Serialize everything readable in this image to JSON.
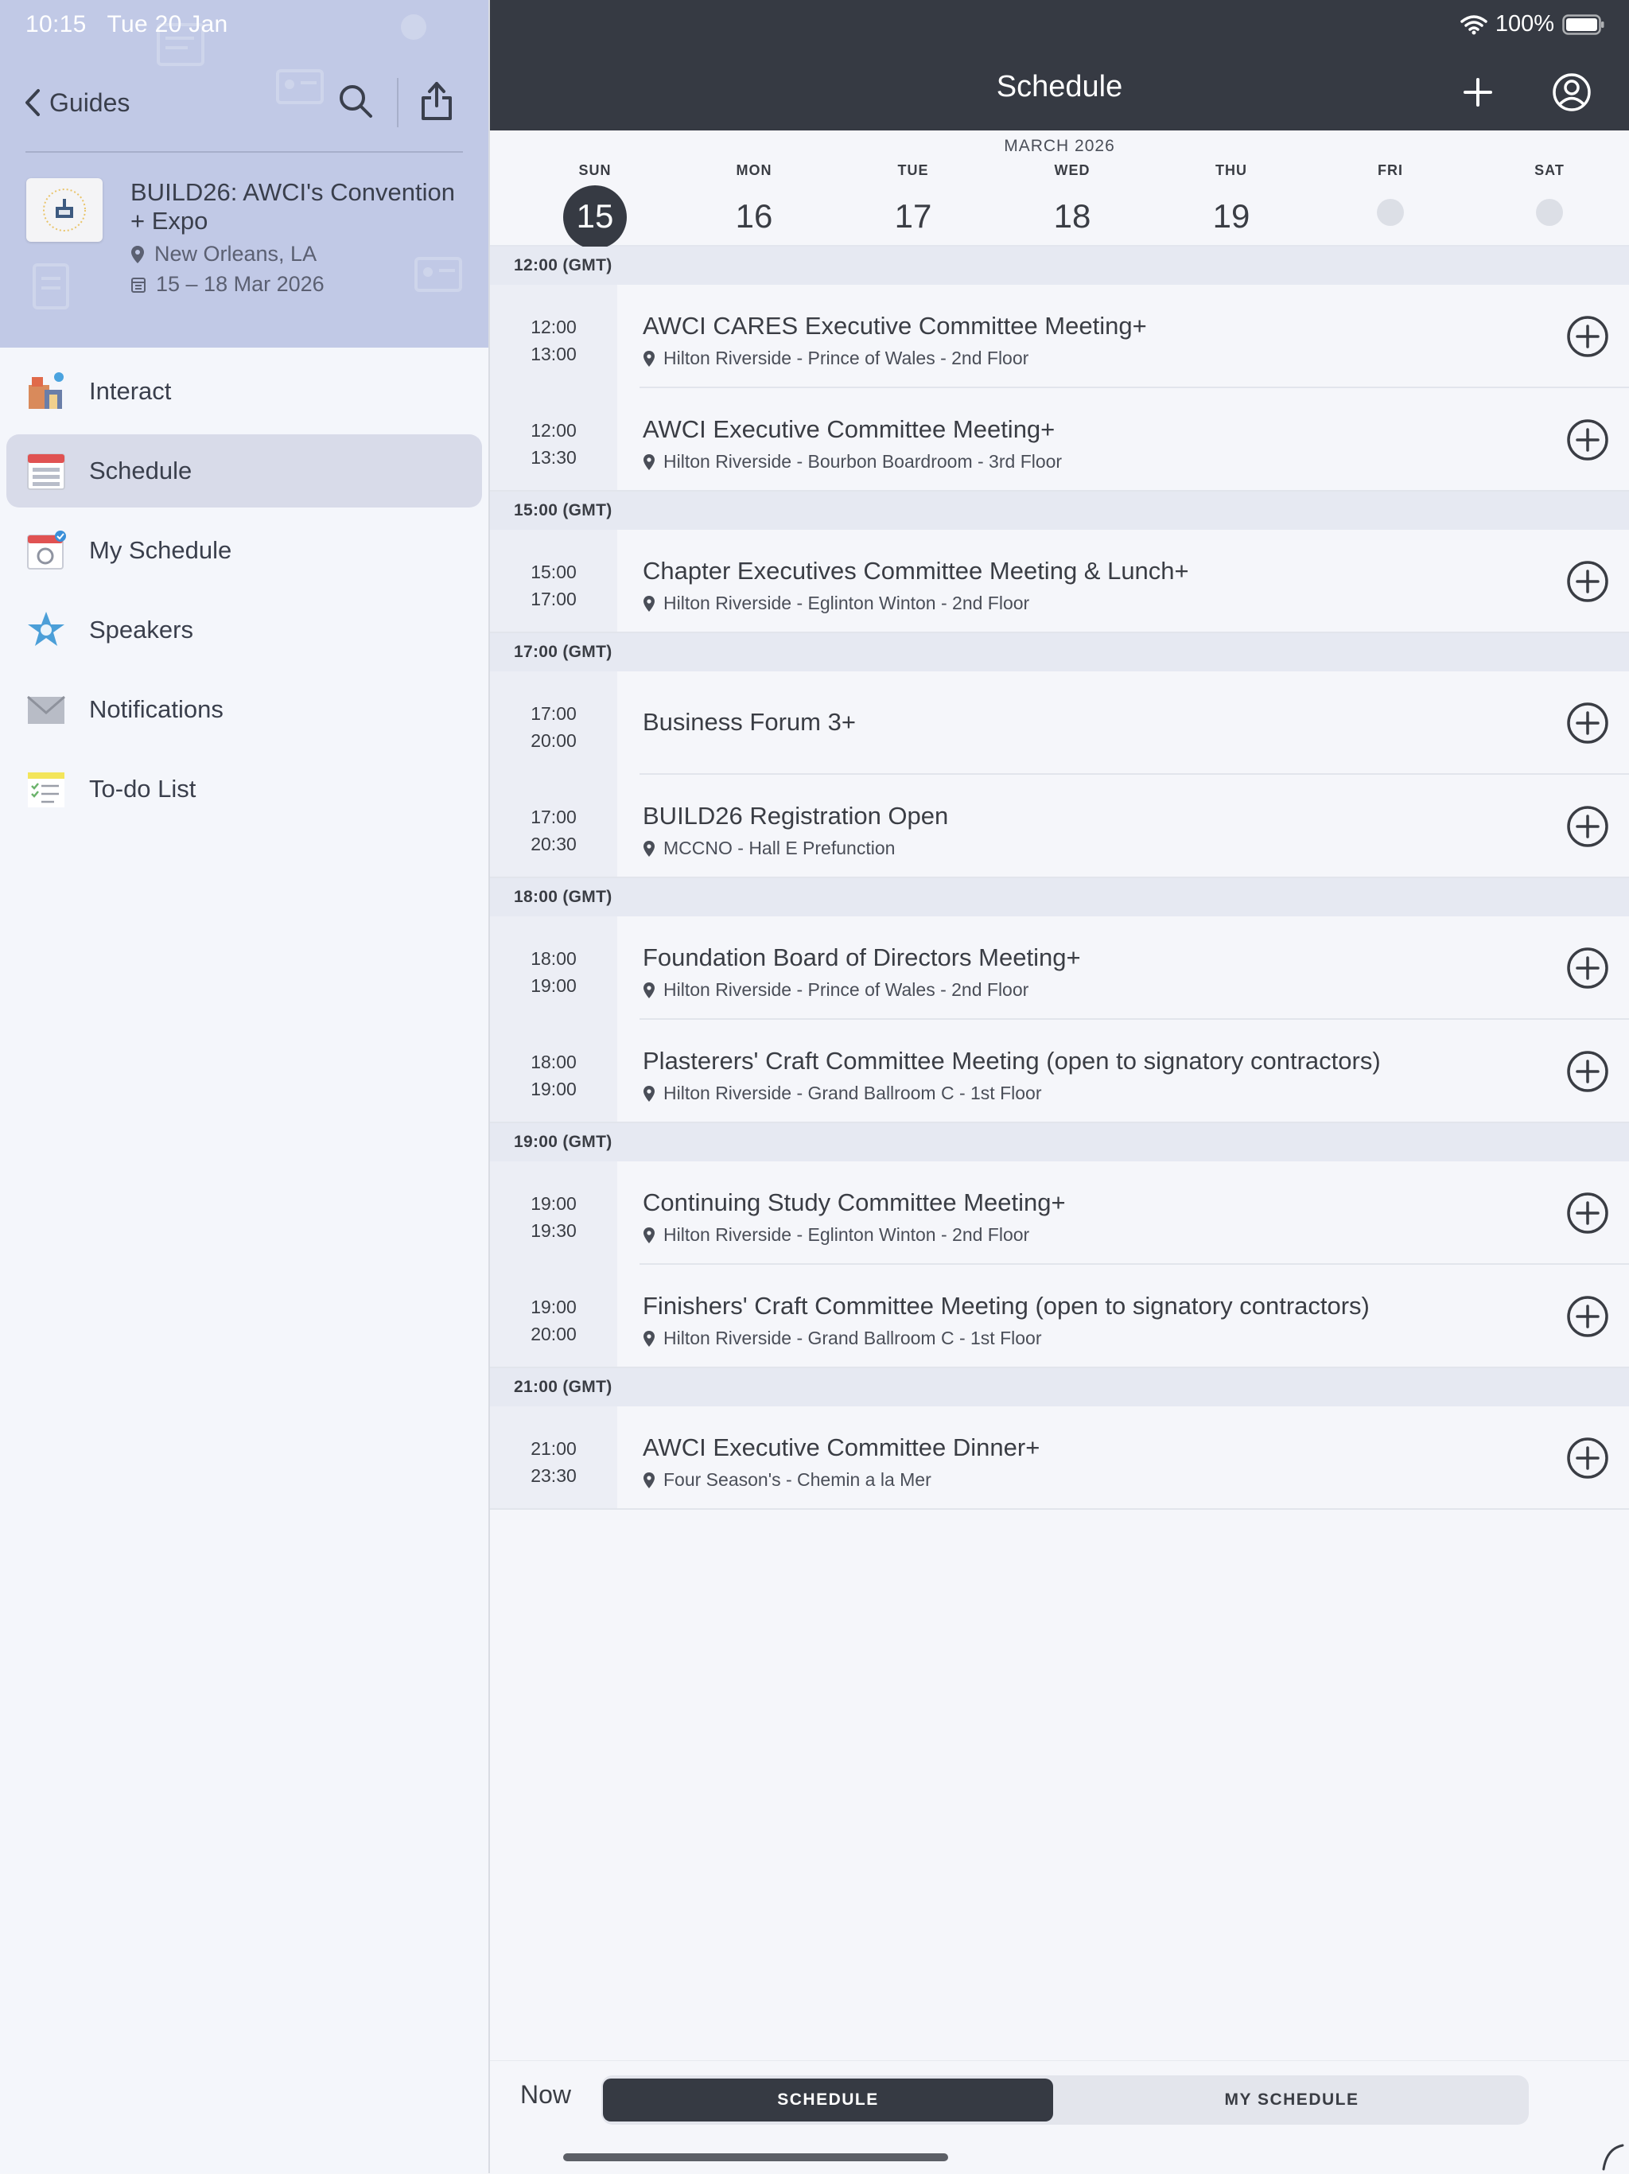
{
  "status_bar": {
    "time": "10:15",
    "date": "Tue 20 Jan",
    "battery": "100%"
  },
  "sidebar": {
    "back_label": "Guides",
    "event": {
      "title": "BUILD26: AWCI's Convention + Expo",
      "location": "New Orleans, LA",
      "dates": "15 – 18 Mar 2026"
    },
    "nav_items": [
      {
        "label": "Interact",
        "icon": "interact-icon",
        "active": false
      },
      {
        "label": "Schedule",
        "icon": "schedule-icon",
        "active": true
      },
      {
        "label": "My Schedule",
        "icon": "my-schedule-icon",
        "active": false
      },
      {
        "label": "Speakers",
        "icon": "star-icon",
        "active": false
      },
      {
        "label": "Notifications",
        "icon": "envelope-icon",
        "active": false
      },
      {
        "label": "To-do List",
        "icon": "todo-list-icon",
        "active": false
      }
    ]
  },
  "header": {
    "title": "Schedule"
  },
  "calendar": {
    "month": "MARCH 2026",
    "days": [
      {
        "name": "SUN",
        "num": "15",
        "selected": true,
        "has_events": true
      },
      {
        "name": "MON",
        "num": "16",
        "selected": false,
        "has_events": true
      },
      {
        "name": "TUE",
        "num": "17",
        "selected": false,
        "has_events": true
      },
      {
        "name": "WED",
        "num": "18",
        "selected": false,
        "has_events": true
      },
      {
        "name": "THU",
        "num": "19",
        "selected": false,
        "has_events": true
      },
      {
        "name": "FRI",
        "num": "",
        "selected": false,
        "has_events": false
      },
      {
        "name": "SAT",
        "num": "",
        "selected": false,
        "has_events": false
      }
    ]
  },
  "schedule": {
    "groups": [
      {
        "header": "12:00 (GMT)",
        "sessions": [
          {
            "start": "12:00",
            "end": "13:00",
            "title": "AWCI CARES Executive Committee Meeting+",
            "location": "Hilton Riverside - Prince of Wales - 2nd Floor"
          },
          {
            "start": "12:00",
            "end": "13:30",
            "title": "AWCI Executive Committee Meeting+",
            "location": "Hilton Riverside - Bourbon Boardroom - 3rd Floor"
          }
        ]
      },
      {
        "header": "15:00 (GMT)",
        "sessions": [
          {
            "start": "15:00",
            "end": "17:00",
            "title": "Chapter Executives Committee Meeting & Lunch+",
            "location": "Hilton Riverside - Eglinton Winton - 2nd Floor"
          }
        ]
      },
      {
        "header": "17:00 (GMT)",
        "sessions": [
          {
            "start": "17:00",
            "end": "20:00",
            "title": "Business Forum 3+",
            "location": ""
          },
          {
            "start": "17:00",
            "end": "20:30",
            "title": "BUILD26 Registration Open",
            "location": "MCCNO - Hall E Prefunction"
          }
        ]
      },
      {
        "header": "18:00 (GMT)",
        "sessions": [
          {
            "start": "18:00",
            "end": "19:00",
            "title": "Foundation Board of Directors Meeting+",
            "location": "Hilton Riverside - Prince of Wales - 2nd Floor"
          },
          {
            "start": "18:00",
            "end": "19:00",
            "title": "Plasterers' Craft Committee Meeting (open to signatory contractors)",
            "location": "Hilton Riverside - Grand Ballroom C - 1st Floor"
          }
        ]
      },
      {
        "header": "19:00 (GMT)",
        "sessions": [
          {
            "start": "19:00",
            "end": "19:30",
            "title": "Continuing Study Committee Meeting+",
            "location": "Hilton Riverside - Eglinton Winton - 2nd Floor"
          },
          {
            "start": "19:00",
            "end": "20:00",
            "title": "Finishers' Craft Committee Meeting (open to signatory contractors)",
            "location": "Hilton Riverside - Grand Ballroom C - 1st Floor"
          }
        ]
      },
      {
        "header": "21:00 (GMT)",
        "sessions": [
          {
            "start": "21:00",
            "end": "23:30",
            "title": "AWCI Executive Committee Dinner+",
            "location": "Four Season's - Chemin a la Mer"
          }
        ]
      }
    ]
  },
  "bottom": {
    "now_label": "Now",
    "tabs": [
      {
        "label": "SCHEDULE",
        "active": true
      },
      {
        "label": "MY SCHEDULE",
        "active": false
      }
    ]
  },
  "colors": {
    "header_dark": "#363a43",
    "sidebar_header": "#c1c9e6",
    "active_nav": "#d8dbe9",
    "group_header": "#e6e9f2"
  }
}
